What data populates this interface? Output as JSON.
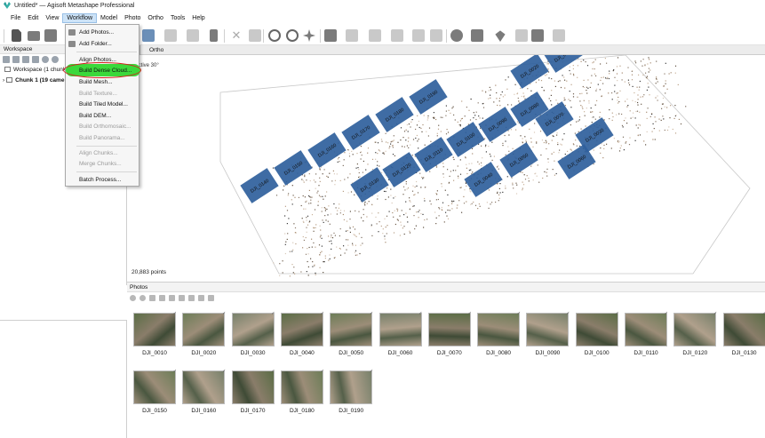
{
  "window": {
    "title": "Untitled* — Agisoft Metashape Professional"
  },
  "menubar": [
    "File",
    "Edit",
    "View",
    "Workflow",
    "Model",
    "Photo",
    "Ortho",
    "Tools",
    "Help"
  ],
  "workflow_menu": {
    "items": [
      {
        "label": "Add Photos...",
        "enabled": true,
        "icon": "add-photos-icon"
      },
      {
        "label": "Add Folder...",
        "enabled": true,
        "icon": "add-folder-icon"
      },
      {
        "label": "Align Photos...",
        "enabled": true
      },
      {
        "label": "Build Dense Cloud...",
        "enabled": true,
        "highlighted": true
      },
      {
        "label": "Build Mesh...",
        "enabled": true
      },
      {
        "label": "Build Texture...",
        "enabled": false
      },
      {
        "label": "Build Tiled Model...",
        "enabled": true
      },
      {
        "label": "Build DEM...",
        "enabled": true
      },
      {
        "label": "Build Orthomosaic...",
        "enabled": false
      },
      {
        "label": "Build Panorama...",
        "enabled": false
      },
      {
        "label": "Align Chunks...",
        "enabled": false
      },
      {
        "label": "Merge Chunks...",
        "enabled": false
      },
      {
        "label": "Batch Process...",
        "enabled": true
      }
    ],
    "highlight_color": "#3bd83b",
    "annotation_color": "#d62020"
  },
  "workspace": {
    "header": "Workspace",
    "root_label": "Workspace (1 chunks,",
    "chunk_label": "Chunk 1 (19 came"
  },
  "model_view": {
    "tabs": [
      "el",
      "Ortho"
    ],
    "perspective": "spective 30°",
    "point_count": "20,883 points",
    "camera_color": "#2f5f9c",
    "cameras": [
      "DJI_0010",
      "DJI_0020",
      "DJI_0030",
      "DJI_0040",
      "DJI_0050",
      "DJI_0060",
      "DJI_0070",
      "DJI_0080",
      "DJI_0090",
      "DJI_0100",
      "DJI_0110",
      "DJI_0120",
      "DJI_0130",
      "DJI_0140",
      "DJI_0150",
      "DJI_0160",
      "DJI_0170",
      "DJI_0180",
      "DJI_0190"
    ]
  },
  "photos": {
    "header": "Photos",
    "items": [
      "DJI_0010",
      "DJI_0020",
      "DJI_0030",
      "DJI_0040",
      "DJI_0050",
      "DJI_0060",
      "DJI_0070",
      "DJI_0080",
      "DJI_0090",
      "DJI_0100",
      "DJI_0110",
      "DJI_0120",
      "DJI_0130",
      "DJI_0150",
      "DJI_0160",
      "DJI_0170",
      "DJI_0180",
      "DJI_0190"
    ]
  }
}
